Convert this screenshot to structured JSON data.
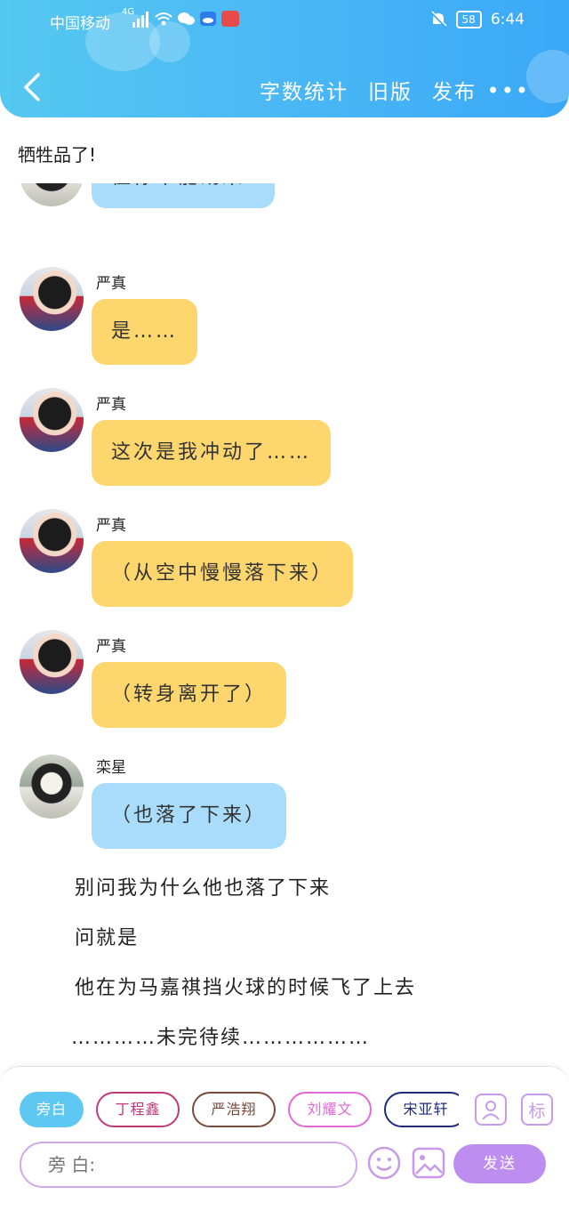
{
  "status_bar": {
    "carrier": "中国移动",
    "network": "4G",
    "battery": "58",
    "time": "6:44"
  },
  "header": {
    "actions": [
      "字数统计",
      "旧版",
      "发布"
    ],
    "more": "•••"
  },
  "story_title": "牺牲品了!",
  "messages": [
    {
      "sender": "",
      "text": "但你不能胡来!",
      "color": "blue",
      "avatar": "luanxing"
    },
    {
      "sender": "严真",
      "text": "是……",
      "color": "yellow",
      "avatar": "yanzhen"
    },
    {
      "sender": "严真",
      "text": "这次是我冲动了……",
      "color": "yellow",
      "avatar": "yanzhen"
    },
    {
      "sender": "严真",
      "text": "（从空中慢慢落下来）",
      "color": "yellow",
      "avatar": "yanzhen"
    },
    {
      "sender": "严真",
      "text": "（转身离开了）",
      "color": "yellow",
      "avatar": "yanzhen"
    },
    {
      "sender": "栾星",
      "text": "（也落了下来）",
      "color": "blue",
      "avatar": "luanxing"
    }
  ],
  "narration": [
    "别问我为什么他也落了下来",
    "问就是",
    "他在为马嘉祺挡火球的时候飞了上去",
    "…………未完待续………………"
  ],
  "composer": {
    "chips": [
      "旁白",
      "丁程鑫",
      "严浩翔",
      "刘耀文",
      "宋亚轩"
    ],
    "chip_colors": [
      "#5ec8f2",
      "#c0397a",
      "#7a4a3a",
      "#e26ad8",
      "#1f2a7a"
    ],
    "tag_label": "标",
    "input_placeholder": "旁 白:",
    "send_label": "发送"
  },
  "colors": {
    "header_gradient_start": "#55c8f0",
    "header_gradient_end": "#3aa8f6",
    "bubble_yellow": "#fed66e",
    "bubble_blue": "#a9dcfa",
    "accent_purple": "#bd8ef0"
  }
}
